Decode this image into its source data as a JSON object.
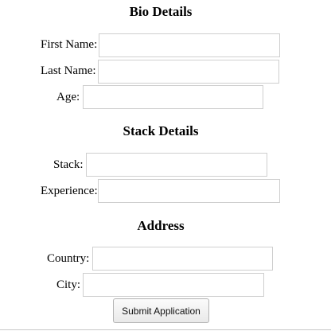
{
  "sections": {
    "bio": {
      "title": "Bio Details",
      "first_name": {
        "label": "First Name:",
        "value": ""
      },
      "last_name": {
        "label": "Last Name:",
        "value": ""
      },
      "age": {
        "label": "Age:",
        "value": ""
      }
    },
    "stack": {
      "title": "Stack Details",
      "stack": {
        "label": "Stack:",
        "value": ""
      },
      "experience": {
        "label": "Experience:",
        "value": ""
      }
    },
    "address": {
      "title": "Address",
      "country": {
        "label": "Country:",
        "value": ""
      },
      "city": {
        "label": "City:",
        "value": ""
      }
    }
  },
  "form": {
    "submit_label": "Submit Application"
  }
}
